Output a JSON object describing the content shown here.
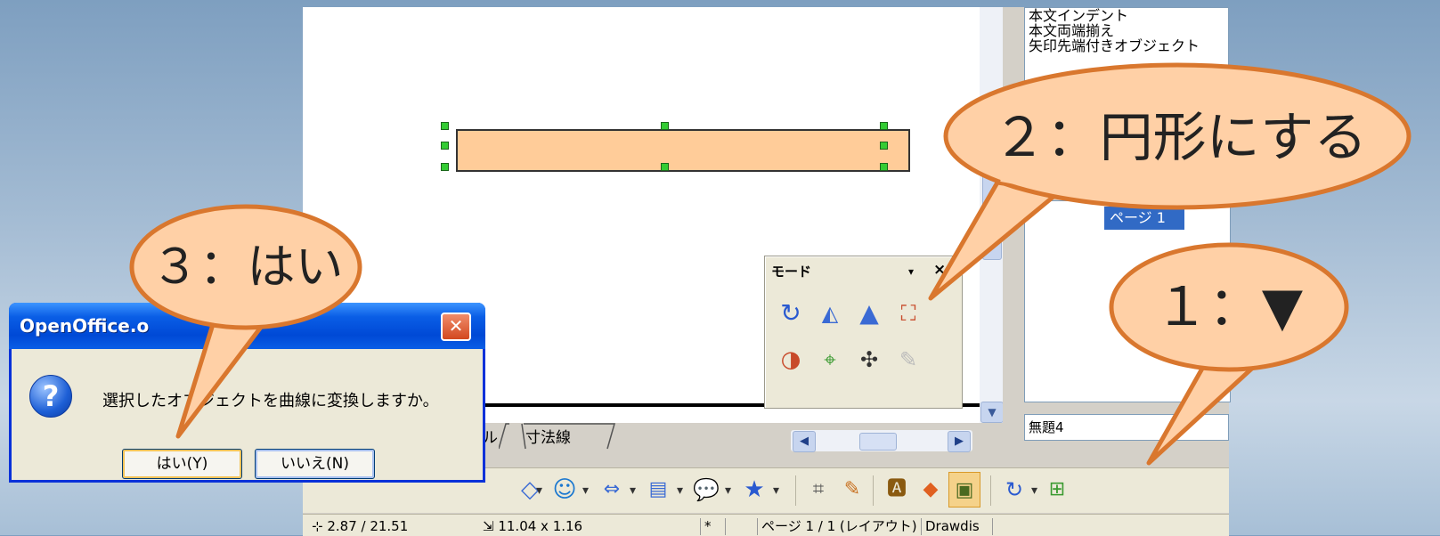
{
  "style_list": {
    "items": [
      "本文インデント",
      "本文両端揃え",
      "矢印先端付きオブジェクト"
    ]
  },
  "pages_pane": {
    "selected_page": "ページ 1"
  },
  "document_field": {
    "value": "無題4"
  },
  "tabs": [
    "ル",
    "寸法線"
  ],
  "mode_toolbar": {
    "title": "モード",
    "menu_glyph": "▾",
    "close_glyph": "×"
  },
  "dialog": {
    "title": "OpenOffice.o",
    "close_glyph": "✕",
    "question_glyph": "?",
    "message": "選択したオブジェクトを曲線に変換しますか。",
    "yes_label": "はい(Y)",
    "no_label": "いいえ(N)"
  },
  "status_bar": {
    "position": "2.87 / 21.51",
    "size": "11.04 x 1.16",
    "modified": "*",
    "page": "ページ 1 / 1 (レイアウト)",
    "layout": "Drawdis"
  },
  "callouts": {
    "step1": "１：▼",
    "step2": "２：円形にする",
    "step3": "３：はい"
  },
  "colors": {
    "shape_fill": "#ffcc99",
    "callout_fill": "#ffd0a6",
    "callout_stroke": "#d9772e",
    "dialog_title_blue": "#0a5ee6"
  },
  "icons": {
    "toolbar": [
      "rectangle-dropdown",
      "smiley-icon",
      "block-arrow-icon",
      "flowchart-icon",
      "callout-icon",
      "star-icon",
      "points-icon",
      "glue-icon",
      "text-frame-icon",
      "image-icon",
      "extrusion-icon",
      "mode-rotate-icon",
      "effects-icon"
    ],
    "mode": [
      "rotate-icon",
      "flip-icon",
      "to-3d-rotation-icon",
      "in-3d-icon",
      "set-circle-icon",
      "set-to-perspective-icon",
      "transparency-icon",
      "gradient-icon"
    ]
  }
}
